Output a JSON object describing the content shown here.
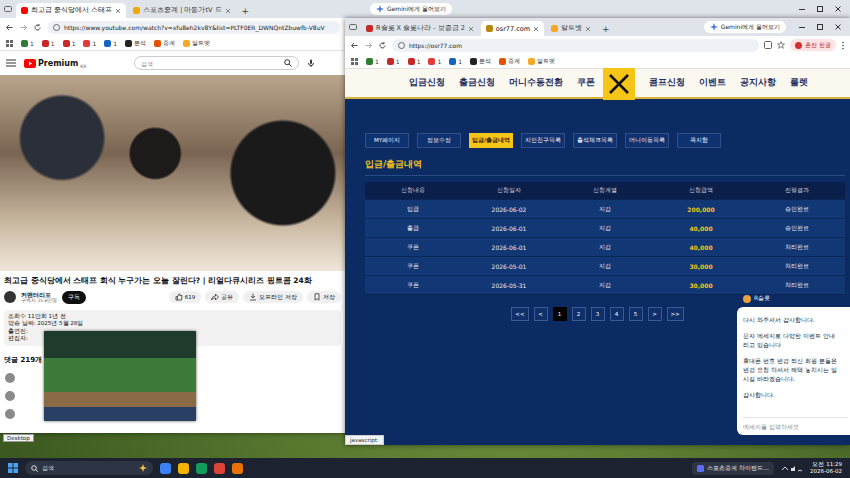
{
  "left_window": {
    "tabs": [
      {
        "label": "최고급 중식당에서 스태프",
        "selected": true,
        "color": "#ff0000"
      },
      {
        "label": "스포츠중계 | 마동가tV 드",
        "selected": false,
        "color": "#f2a900"
      }
    ],
    "new_tab": "+",
    "gemini_button": "Gemini에게 물어보기",
    "address": "https://www.youtube.com/watch?v=xfu8eh2kv8Y&list=PLTF0ER_DWNQntZbuwfb-V8uV",
    "bookmarks": [
      {
        "label": "1",
        "color": "#2e7d32"
      },
      {
        "label": "1",
        "color": "#c62828"
      },
      {
        "label": "1",
        "color": "#c62828"
      },
      {
        "label": "1",
        "color": "#e53935"
      },
      {
        "label": "1",
        "color": "#1565c0"
      },
      {
        "label": "분석",
        "color": "#222222"
      },
      {
        "label": "중계",
        "color": "#e65100"
      },
      {
        "label": "알트벳",
        "color": "#f9a825"
      }
    ],
    "youtube": {
      "logo": "Premium",
      "region": "KR",
      "search_placeholder": "검색",
      "video_title": "최고급 중식당에서 스태프 회식 누구가는 오늘 잘린다? | 리얼다큐시리즈 핑트콤 24화",
      "channel": "커멘터리포",
      "subscribers": "구독자 25.6만명",
      "subscribe": "구독",
      "actions": [
        "619",
        "공유",
        "오프라인 저장",
        "저장"
      ],
      "description": [
        "조회수 11만회 1년 전",
        "방송 날짜: 2025년 5월 28일",
        "출연진:",
        "편집자:"
      ],
      "comments_header": "댓글 219개"
    }
  },
  "right_window": {
    "tabs": [
      {
        "label": "R슬롯 X 슬롯나라 - 보증금 2",
        "selected": false,
        "color": "#c62828"
      },
      {
        "label": "osr77.com",
        "selected": true,
        "color": "#b8860b"
      },
      {
        "label": "알트벳",
        "selected": false,
        "color": "#f9a825"
      }
    ],
    "new_tab": "+",
    "gemini_button": "Gemini에게 물어보기",
    "address": "https://osr77.com",
    "profile": "혼잔 한글",
    "bookmarks": [
      {
        "label": "1",
        "color": "#2e7d32"
      },
      {
        "label": "1",
        "color": "#c62828"
      },
      {
        "label": "1",
        "color": "#c62828"
      },
      {
        "label": "1",
        "color": "#e53935"
      },
      {
        "label": "1",
        "color": "#1565c0"
      },
      {
        "label": "분석",
        "color": "#222222"
      },
      {
        "label": "중계",
        "color": "#e65100"
      },
      {
        "label": "알트벳",
        "color": "#f9a825"
      }
    ],
    "site": {
      "nav": [
        "입금신청",
        "출금신청",
        "머니수동전환",
        "쿠폰",
        "콤프신청",
        "이벤트",
        "공지사항",
        "룰렛"
      ],
      "subtabs": [
        {
          "label": "MY페이지",
          "selected": false
        },
        {
          "label": "정보수정",
          "selected": false
        },
        {
          "label": "입금/출금내역",
          "selected": true
        },
        {
          "label": "지인친구목록",
          "selected": false
        },
        {
          "label": "출석체크목록",
          "selected": false
        },
        {
          "label": "머니이동목록",
          "selected": false
        },
        {
          "label": "쪽지함",
          "selected": false
        }
      ],
      "section_title": "입금/출금내역",
      "table": {
        "columns": [
          "신청내용",
          "신청일자",
          "신청계열",
          "신청금액",
          "진행결과"
        ],
        "rows": [
          [
            "입금",
            "2026-06-02",
            "지갑",
            "200,000",
            "승인완료"
          ],
          [
            "출금",
            "2026-06-01",
            "지갑",
            "40,000",
            "승인완료"
          ],
          [
            "쿠폰",
            "2026-06-01",
            "지갑",
            "40,000",
            "처리완료"
          ],
          [
            "쿠폰",
            "2026-05-01",
            "지갑",
            "30,000",
            "처리완료"
          ],
          [
            "쿠폰",
            "2026-05-31",
            "지갑",
            "30,000",
            "처리완료"
          ]
        ]
      },
      "pagination": [
        {
          "label": "<<",
          "selected": false
        },
        {
          "label": "<",
          "selected": false
        },
        {
          "label": "1",
          "selected": true
        },
        {
          "label": "2",
          "selected": false
        },
        {
          "label": "3",
          "selected": false
        },
        {
          "label": "4",
          "selected": false
        },
        {
          "label": "5",
          "selected": false
        },
        {
          "label": ">",
          "selected": false
        },
        {
          "label": ">>",
          "selected": false
        }
      ]
    },
    "chat": {
      "agent": "R슬롯",
      "messages": [
        [
          "다시 와주셔서 감사합니다."
        ],
        [
          "문자 메세지로 다양한 이벤트 안내",
          "리고 있습니다"
        ],
        [
          "휴대폰 번호 변경 되신 회원 분들은",
          "변경 요청 하셔서 혜택 놓치시는 일",
          "시길 바라겠습니다."
        ],
        [
          "감사합니다."
        ]
      ],
      "input_placeholder": "메세지를 입력하세요"
    },
    "status_bar": "javascript:"
  },
  "desktop_label": "Desktop",
  "taskbar": {
    "search_placeholder": "검색",
    "apps": [
      {
        "color": "#3b82f6"
      },
      {
        "color": "#f4b400"
      },
      {
        "color": "#0f9d58"
      },
      {
        "color": "#db4437"
      },
      {
        "color": "#e8710a"
      }
    ],
    "notification": "스포츠중계 하이랜드...",
    "time": "오전 11:29",
    "date": "2026-06-02"
  }
}
